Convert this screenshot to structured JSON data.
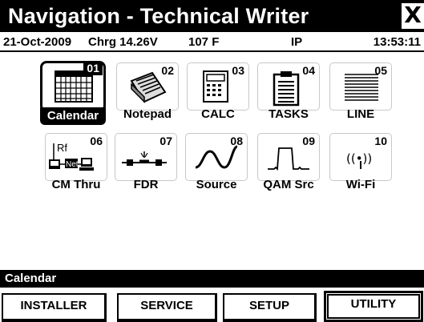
{
  "window": {
    "title": "Navigation - Technical Writer",
    "close_icon": "X"
  },
  "status": {
    "date": "21-Oct-2009",
    "charge": "Chrg 14.26V",
    "temperature": "107 F",
    "network": "IP",
    "time": "13:53:11"
  },
  "apps": [
    {
      "num": "01",
      "label": "Calendar",
      "icon": "calendar-icon",
      "selected": true
    },
    {
      "num": "02",
      "label": "Notepad",
      "icon": "notepad-icon",
      "selected": false
    },
    {
      "num": "03",
      "label": "CALC",
      "icon": "calculator-icon",
      "selected": false
    },
    {
      "num": "04",
      "label": "TASKS",
      "icon": "clipboard-icon",
      "selected": false
    },
    {
      "num": "05",
      "label": "LINE",
      "icon": "lines-icon",
      "selected": false
    },
    {
      "num": "06",
      "label": "CM Thru",
      "icon": "rf-net-icon",
      "icon_text_rf": "Rf",
      "icon_text_net": "Net",
      "selected": false
    },
    {
      "num": "07",
      "label": "FDR",
      "icon": "cable-fault-icon",
      "selected": false
    },
    {
      "num": "08",
      "label": "Source",
      "icon": "sine-wave-icon",
      "selected": false
    },
    {
      "num": "09",
      "label": "QAM Src",
      "icon": "pulse-icon",
      "selected": false
    },
    {
      "num": "10",
      "label": "Wi-Fi",
      "icon": "antenna-icon",
      "icon_text": "((•))",
      "selected": false
    }
  ],
  "selection": {
    "label": "Calendar"
  },
  "softkeys": [
    {
      "label": "INSTALLER",
      "active": false
    },
    {
      "label": "SERVICE",
      "active": false
    },
    {
      "label": "SETUP",
      "active": false
    },
    {
      "label": "UTILITY",
      "active": true
    }
  ]
}
